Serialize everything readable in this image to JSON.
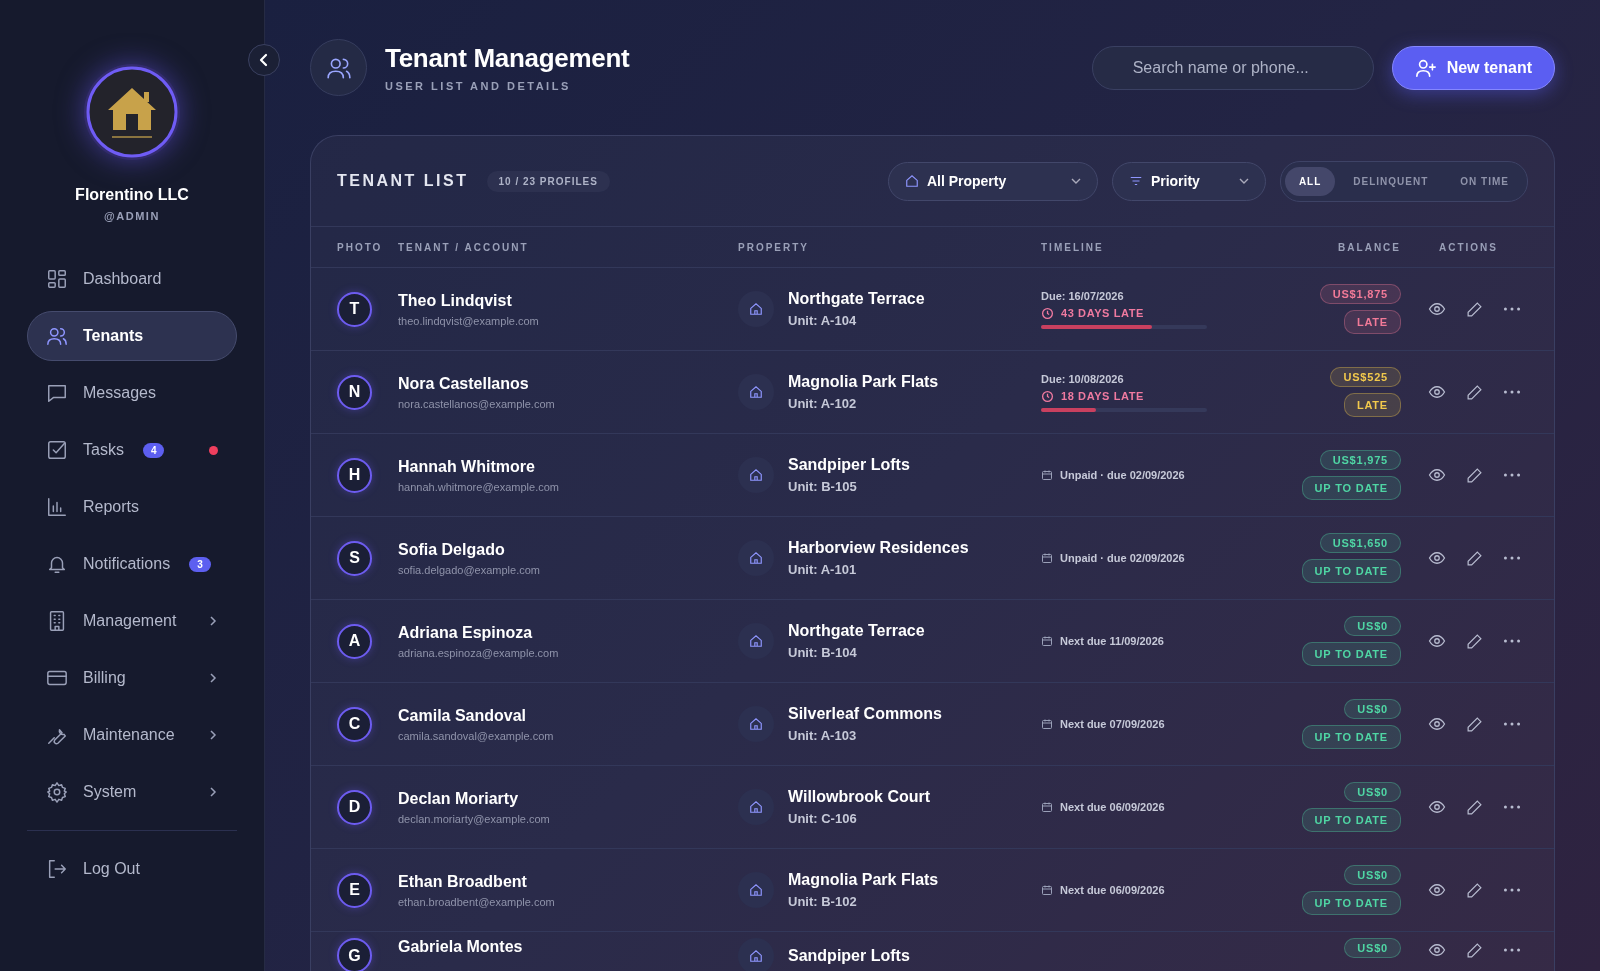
{
  "sidebar": {
    "org_name": "Florentino LLC",
    "handle": "@ADMIN",
    "items": [
      {
        "label": "Dashboard",
        "selected": false
      },
      {
        "label": "Tenants",
        "selected": true
      },
      {
        "label": "Messages",
        "selected": false
      },
      {
        "label": "Tasks",
        "selected": false,
        "badge": "4",
        "alert": true
      },
      {
        "label": "Reports",
        "selected": false
      },
      {
        "label": "Notifications",
        "selected": false,
        "badge": "3"
      },
      {
        "label": "Management",
        "selected": false,
        "expandable": true
      },
      {
        "label": "Billing",
        "selected": false,
        "expandable": true
      },
      {
        "label": "Maintenance",
        "selected": false,
        "expandable": true
      },
      {
        "label": "System",
        "selected": false,
        "expandable": true
      }
    ],
    "logout": "Log Out"
  },
  "header": {
    "title": "Tenant Management",
    "subtitle": "USER LIST AND DETAILS",
    "search": {
      "placeholder": "Search name or phone..."
    },
    "new_button": "New tenant"
  },
  "tenant_list": {
    "title": "TENANT LIST",
    "count": "10 / 23 PROFILES",
    "property_filter": "All Property",
    "priority_filter": "Priority",
    "segments": [
      {
        "label": "ALL",
        "selected": true
      },
      {
        "label": "DELINQUENT",
        "selected": false
      },
      {
        "label": "ON TIME",
        "selected": false
      }
    ],
    "columns": [
      "PHOTO",
      "TENANT / ACCOUNT",
      "PROPERTY",
      "TIMELINE",
      "BALANCE",
      "ACTIONS"
    ],
    "rows": [
      {
        "initial": "T",
        "name": "Theo Lindqvist",
        "email": "theo.lindqvist@example.com",
        "property": "Northgate Terrace",
        "unit": "Unit: A-104",
        "timeline": {
          "kind": "late",
          "due": "Due: 16/07/2026",
          "late": "43 DAYS LATE",
          "level": 0.67
        },
        "balance": "US$1,875",
        "status": "LATE",
        "color": "#f27a98"
      },
      {
        "initial": "N",
        "name": "Nora Castellanos",
        "email": "nora.castellanos@example.com",
        "property": "Magnolia Park Flats",
        "unit": "Unit: A-102",
        "timeline": {
          "kind": "late",
          "due": "Due: 10/08/2026",
          "late": "18 DAYS LATE",
          "level": 0.33
        },
        "balance": "US$525",
        "status": "LATE",
        "color": "#f2c94c"
      },
      {
        "initial": "H",
        "name": "Hannah Whitmore",
        "email": "hannah.whitmore@example.com",
        "property": "Sandpiper Lofts",
        "unit": "Unit: B-105",
        "timeline": {
          "kind": "date",
          "text": "Unpaid · due 02/09/2026"
        },
        "balance": "US$1,975",
        "status": "UP TO DATE",
        "color": "#4fd6a4"
      },
      {
        "initial": "S",
        "name": "Sofia Delgado",
        "email": "sofia.delgado@example.com",
        "property": "Harborview Residences",
        "unit": "Unit: A-101",
        "timeline": {
          "kind": "date",
          "text": "Unpaid · due 02/09/2026"
        },
        "balance": "US$1,650",
        "status": "UP TO DATE",
        "color": "#4fd6a4"
      },
      {
        "initial": "A",
        "name": "Adriana Espinoza",
        "email": "adriana.espinoza@example.com",
        "property": "Northgate Terrace",
        "unit": "Unit: B-104",
        "timeline": {
          "kind": "date",
          "text": "Next due 11/09/2026"
        },
        "balance": "US$0",
        "status": "UP TO DATE",
        "color": "#4fd6a4"
      },
      {
        "initial": "C",
        "name": "Camila Sandoval",
        "email": "camila.sandoval@example.com",
        "property": "Silverleaf Commons",
        "unit": "Unit: A-103",
        "timeline": {
          "kind": "date",
          "text": "Next due 07/09/2026"
        },
        "balance": "US$0",
        "status": "UP TO DATE",
        "color": "#4fd6a4"
      },
      {
        "initial": "D",
        "name": "Declan Moriarty",
        "email": "declan.moriarty@example.com",
        "property": "Willowbrook Court",
        "unit": "Unit: C-106",
        "timeline": {
          "kind": "date",
          "text": "Next due 06/09/2026"
        },
        "balance": "US$0",
        "status": "UP TO DATE",
        "color": "#4fd6a4"
      },
      {
        "initial": "E",
        "name": "Ethan Broadbent",
        "email": "ethan.broadbent@example.com",
        "property": "Magnolia Park Flats",
        "unit": "Unit: B-102",
        "timeline": {
          "kind": "date",
          "text": "Next due 06/09/2026"
        },
        "balance": "US$0",
        "status": "UP TO DATE",
        "color": "#4fd6a4"
      },
      {
        "initial": "G",
        "name": "Gabriela Montes",
        "property": "Sandpiper Lofts",
        "balance": "US$0",
        "color": "#4fd6a4"
      }
    ]
  }
}
